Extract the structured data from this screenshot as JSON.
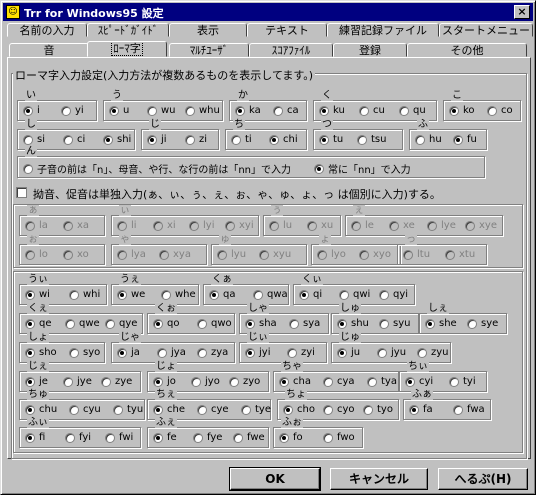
{
  "window": {
    "title": "Trr for Windows95 設定",
    "app_icon": "app-icon",
    "close": "×"
  },
  "tabs_row1": [
    "名前の入力",
    "ｽﾋﾟｰﾄﾞｶﾞｲﾄﾞ",
    "表示",
    "テキスト",
    "練習記録ファイル",
    "スタートメニュー"
  ],
  "tabs_row2": [
    "音",
    "ﾛｰﾏ字",
    "ﾏﾙﾁﾕｰｻﾞ",
    "ｽｺｱﾌｧｲﾙ",
    "登録",
    "その他"
  ],
  "selected_tab": "ﾛｰﾏ字",
  "group_title": "ローマ字入力設定(入力方法が複数あるものを表示してます。)",
  "set1": [
    {
      "kana": "い",
      "opts": [
        "i",
        "yi"
      ],
      "sel": 0
    },
    {
      "kana": "う",
      "opts": [
        "u",
        "wu",
        "whu"
      ],
      "sel": 0
    },
    {
      "kana": "か",
      "opts": [
        "ka",
        "ca"
      ],
      "sel": 0
    },
    {
      "kana": "く",
      "opts": [
        "ku",
        "cu",
        "qu"
      ],
      "sel": 0
    },
    {
      "kana": "こ",
      "opts": [
        "ko",
        "co"
      ],
      "sel": 0
    },
    {
      "kana": "し",
      "opts": [
        "si",
        "ci",
        "shi"
      ],
      "sel": 2
    },
    {
      "kana": "じ",
      "opts": [
        "ji",
        "zi"
      ],
      "sel": 0
    },
    {
      "kana": "ち",
      "opts": [
        "ti",
        "chi"
      ],
      "sel": 1
    },
    {
      "kana": "つ",
      "opts": [
        "tu",
        "tsu"
      ],
      "sel": 0
    },
    {
      "kana": "ふ",
      "opts": [
        "hu",
        "fu"
      ],
      "sel": 1
    }
  ],
  "n_setting": {
    "kana": "ん",
    "opts": [
      "子音の前は「n」、母音、や行、な行の前は「nn」で入力",
      "常に「nn」で入力"
    ],
    "sel": 1
  },
  "small_checkbox": {
    "label": "拗音、促音は単独入力(ぁ、ぃ、ぅ、ぇ、ぉ、ゃ、ゅ、ょ、っ は個別に入力)する。",
    "checked": false
  },
  "set2": [
    {
      "kana": "ぁ",
      "opts": [
        "la",
        "xa"
      ],
      "sel": -1
    },
    {
      "kana": "ぃ",
      "opts": [
        "li",
        "xi",
        "lyi",
        "xyi"
      ],
      "sel": -1
    },
    {
      "kana": "ぅ",
      "opts": [
        "lu",
        "xu"
      ],
      "sel": -1
    },
    {
      "kana": "ぇ",
      "opts": [
        "le",
        "xe",
        "lye",
        "xye"
      ],
      "sel": -1
    },
    {
      "kana": "ぉ",
      "opts": [
        "lo",
        "xo"
      ],
      "sel": -1
    },
    {
      "kana": "ゃ",
      "opts": [
        "lya",
        "xya"
      ],
      "sel": -1
    },
    {
      "kana": "ゅ",
      "opts": [
        "lyu",
        "xyu"
      ],
      "sel": -1
    },
    {
      "kana": "ょ",
      "opts": [
        "lyo",
        "xyo"
      ],
      "sel": -1
    },
    {
      "kana": "っ",
      "opts": [
        "ltu",
        "xtu"
      ],
      "sel": -1
    }
  ],
  "set3": [
    {
      "kana": "うぃ",
      "opts": [
        "wi",
        "whi"
      ],
      "sel": 0
    },
    {
      "kana": "うぇ",
      "opts": [
        "we",
        "whe"
      ],
      "sel": 0
    },
    {
      "kana": "くぁ",
      "opts": [
        "qa",
        "qwa"
      ],
      "sel": 0
    },
    {
      "kana": "くぃ",
      "opts": [
        "qi",
        "qwi",
        "qyi"
      ],
      "sel": 0
    },
    {
      "kana": "くぇ",
      "opts": [
        "qe",
        "qwe",
        "qye"
      ],
      "sel": 0
    },
    {
      "kana": "くぉ",
      "opts": [
        "qo",
        "qwo"
      ],
      "sel": 0
    },
    {
      "kana": "しゃ",
      "opts": [
        "sha",
        "sya"
      ],
      "sel": 0
    },
    {
      "kana": "しゅ",
      "opts": [
        "shu",
        "syu"
      ],
      "sel": 0
    },
    {
      "kana": "しぇ",
      "opts": [
        "she",
        "sye"
      ],
      "sel": 0
    },
    {
      "kana": "しょ",
      "opts": [
        "sho",
        "syo"
      ],
      "sel": 0
    },
    {
      "kana": "じゃ",
      "opts": [
        "ja",
        "jya",
        "zya"
      ],
      "sel": 0
    },
    {
      "kana": "じぃ",
      "opts": [
        "jyi",
        "zyi"
      ],
      "sel": 0
    },
    {
      "kana": "じゅ",
      "opts": [
        "ju",
        "jyu",
        "zyu"
      ],
      "sel": 0
    },
    {
      "kana": "じぇ",
      "opts": [
        "je",
        "jye",
        "zye"
      ],
      "sel": 0
    },
    {
      "kana": "じょ",
      "opts": [
        "jo",
        "jyo",
        "zyo"
      ],
      "sel": 0
    },
    {
      "kana": "ちゃ",
      "opts": [
        "cha",
        "cya",
        "tya"
      ],
      "sel": 0
    },
    {
      "kana": "ちぃ",
      "opts": [
        "cyi",
        "tyi"
      ],
      "sel": 0
    },
    {
      "kana": "ちゅ",
      "opts": [
        "chu",
        "cyu",
        "tyu"
      ],
      "sel": 0
    },
    {
      "kana": "ちぇ",
      "opts": [
        "che",
        "cye",
        "tye"
      ],
      "sel": 0
    },
    {
      "kana": "ちょ",
      "opts": [
        "cho",
        "cyo",
        "tyo"
      ],
      "sel": 0
    },
    {
      "kana": "ふぁ",
      "opts": [
        "fa",
        "fwa"
      ],
      "sel": 0
    },
    {
      "kana": "ふぃ",
      "opts": [
        "fi",
        "fyi",
        "fwi"
      ],
      "sel": 0
    },
    {
      "kana": "ふぇ",
      "opts": [
        "fe",
        "fye",
        "fwe"
      ],
      "sel": 0
    },
    {
      "kana": "ふぉ",
      "opts": [
        "fo",
        "fwo"
      ],
      "sel": 0
    }
  ],
  "buttons": {
    "ok": "OK",
    "cancel": "キャンセル",
    "help": "へるぷ(H)"
  }
}
